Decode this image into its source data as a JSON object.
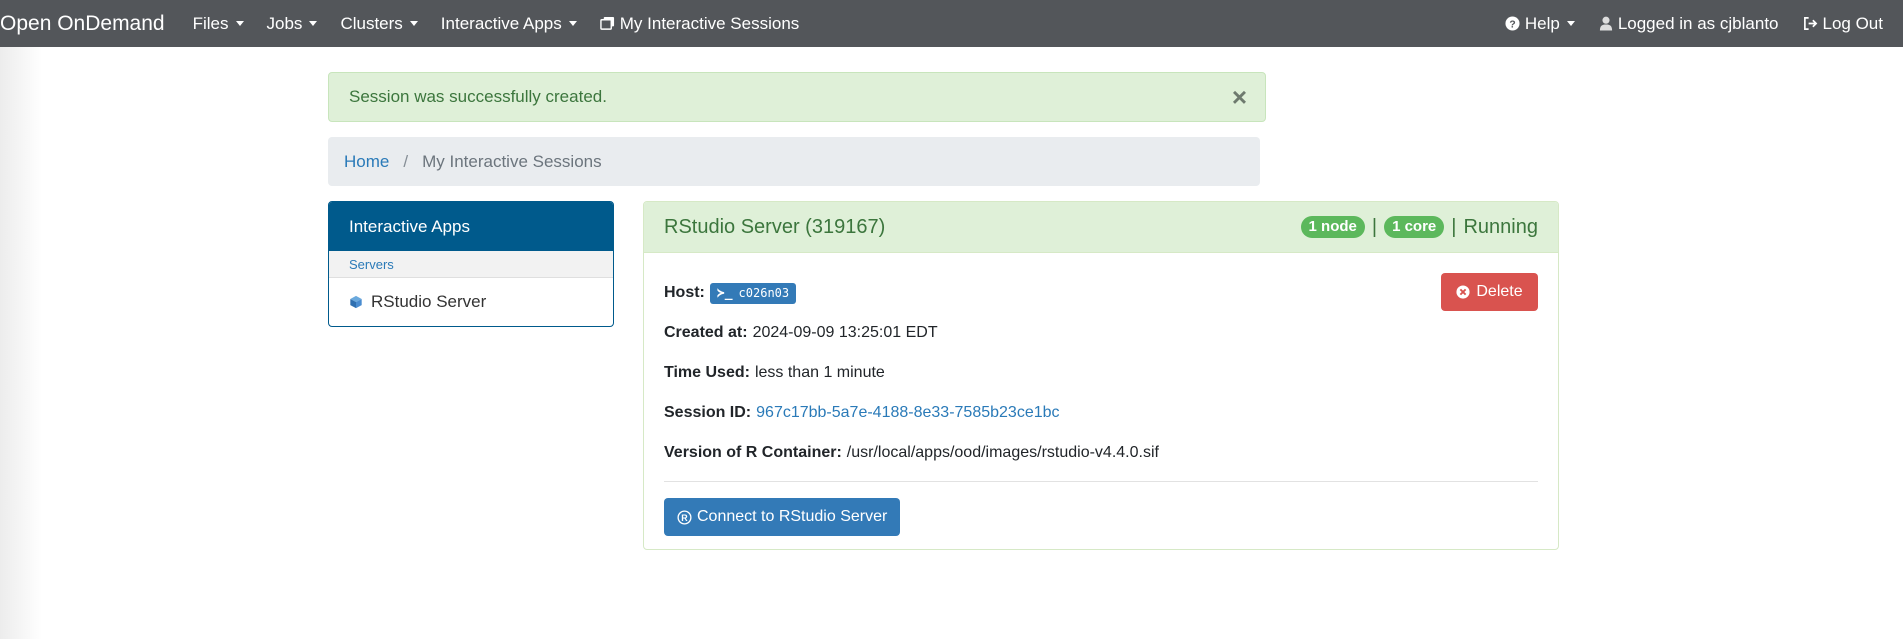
{
  "navbar": {
    "brand": "Open OnDemand",
    "menus": [
      {
        "label": "Files"
      },
      {
        "label": "Jobs"
      },
      {
        "label": "Clusters"
      },
      {
        "label": "Interactive Apps"
      }
    ],
    "sessions_link": "My Interactive Sessions",
    "help": "Help",
    "user": "Logged in as cjblanto",
    "logout": "Log Out"
  },
  "alert": {
    "message": "Session was successfully created.",
    "close": "×"
  },
  "breadcrumb": {
    "home": "Home",
    "separator": "/",
    "current": "My Interactive Sessions"
  },
  "sidebar": {
    "header": "Interactive Apps",
    "section": "Servers",
    "items": [
      {
        "label": "RStudio Server",
        "icon": "cube-icon"
      }
    ]
  },
  "session": {
    "title": "RStudio Server (319167)",
    "nodes_badge": "1 node",
    "cores_badge": "1 core",
    "separator": "|",
    "status": "Running",
    "delete_label": "Delete",
    "host_label": "Host:",
    "host_prompt": "≻_",
    "host_value": "c026n03",
    "created_label": "Created at:",
    "created_value": "2024-09-09 13:25:01 EDT",
    "time_label": "Time Used:",
    "time_value": "less than 1 minute",
    "id_label": "Session ID:",
    "id_value": "967c17bb-5a7e-4188-8e33-7585b23ce1bc",
    "version_label": "Version of R Container:",
    "version_value": "/usr/local/apps/ood/images/rstudio-v4.4.0.sif",
    "connect_label": "Connect to RStudio Server"
  },
  "colors": {
    "navbar": "#53565a",
    "sidebar_accent": "#005a8c",
    "success_bg": "#dff0d8",
    "success_text": "#3c763d",
    "badge": "#5cb85c",
    "primary": "#337ab7",
    "danger": "#d9534f",
    "link": "#2a7ab8"
  }
}
